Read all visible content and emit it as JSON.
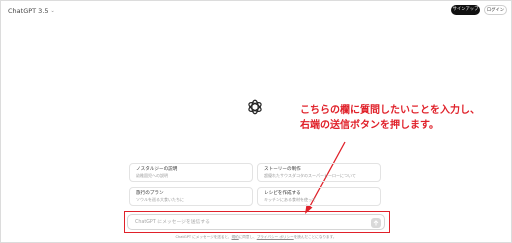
{
  "header": {
    "model_name": "ChatGPT 3.5",
    "signup_label": "サインアップ",
    "login_label": "ログイン"
  },
  "annotation": {
    "line1": "こちらの欄に質問したいことを入力し、",
    "line2": "右端の送信ボタンを押します。",
    "color": "#e0212a"
  },
  "suggestions": [
    {
      "title": "ノスタルジーの説明",
      "subtitle": "幼稚園児への説明"
    },
    {
      "title": "ストーリーの制作",
      "subtitle": "超優れたサウスダコタのスーパーヒーローについて"
    },
    {
      "title": "旅行のプラン",
      "subtitle": "ソウルを巡る大食いたちに"
    },
    {
      "title": "レシピを作成する",
      "subtitle": "キッチンにある食材を使って"
    }
  ],
  "composer": {
    "placeholder": "ChatGPT にメッセージを送信する"
  },
  "footer": {
    "prefix": "ChatGPT にメッセージを送ると、",
    "terms": "規約",
    "middle": "に同意し、",
    "privacy": "プライバシー ポリシー",
    "suffix": "を読んだことになります。"
  }
}
